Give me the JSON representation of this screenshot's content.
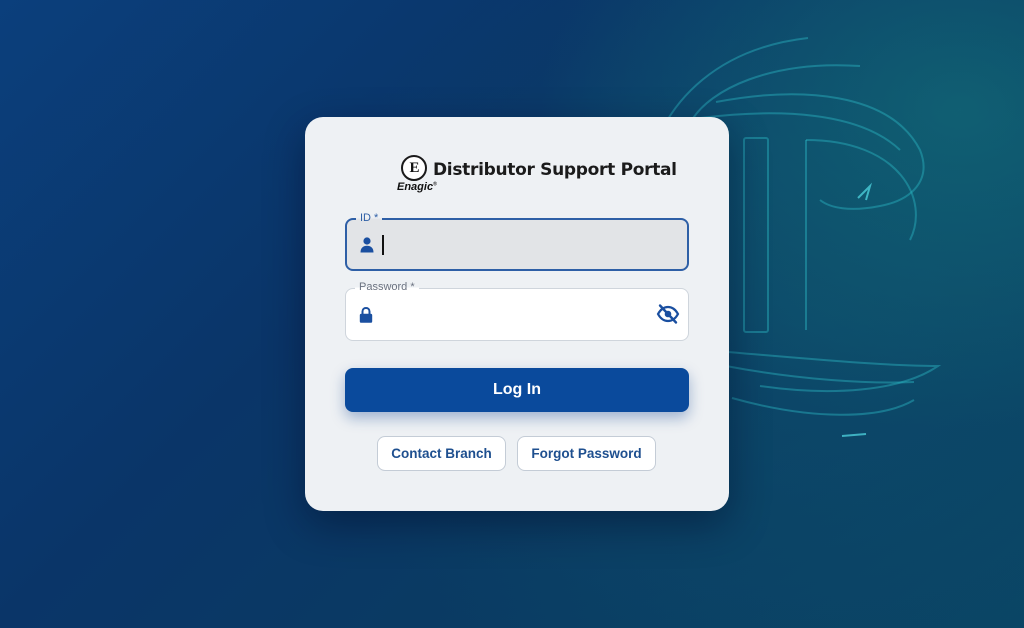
{
  "app": {
    "brand_logo_text": "E",
    "brand_wordmark": "Enagic",
    "brand_trademark": "®",
    "title": "Distributor Support Portal"
  },
  "form": {
    "id_field": {
      "label": "ID *",
      "value": "",
      "icon": "person-icon"
    },
    "password_field": {
      "label": "Password *",
      "value": "",
      "icon": "lock-icon",
      "toggle_icon": "eye-slash-icon"
    },
    "login_button": "Log In"
  },
  "links": {
    "contact_branch": "Contact Branch",
    "forgot_password": "Forgot Password"
  },
  "colors": {
    "primary": "#0a4a9c",
    "link_text": "#1e4f8f",
    "card_bg": "#eef1f4",
    "background_dark": "#0a3568",
    "background_teal": "#14787d"
  }
}
